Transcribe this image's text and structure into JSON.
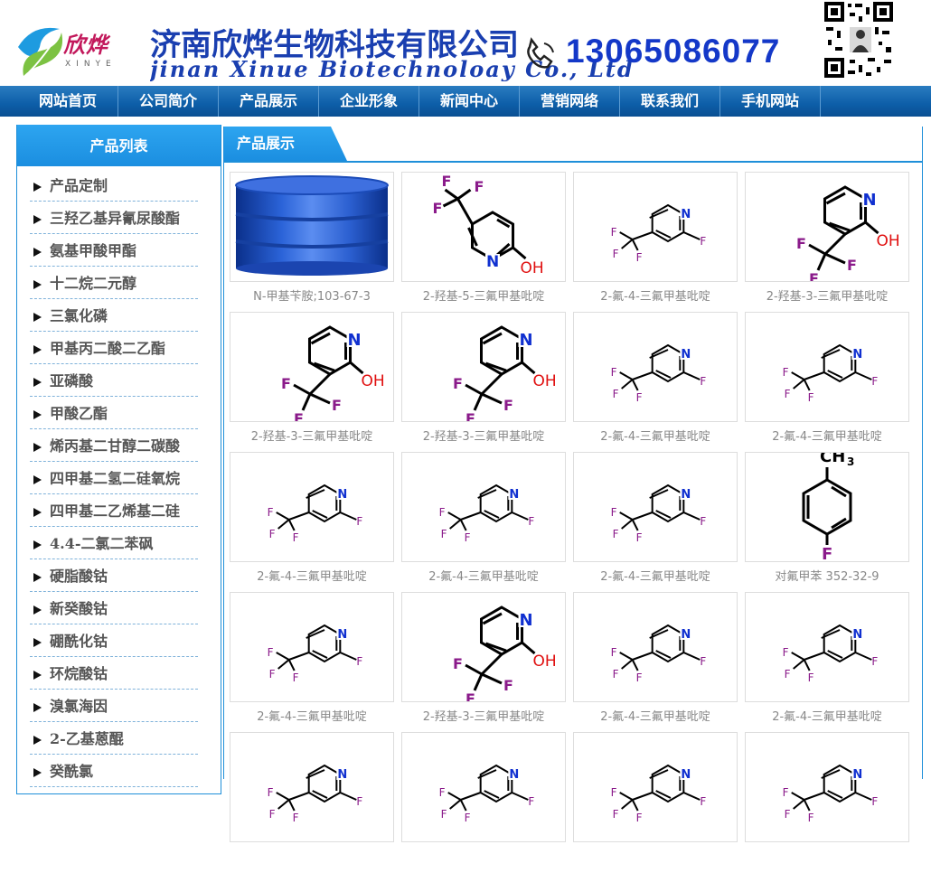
{
  "header": {
    "logo_cn": "欣烨",
    "logo_en": "XINYE",
    "company_cn": "济南欣烨生物科技有限公司",
    "company_en": "jinan Xinue Biotechnoloay Co., Ltd",
    "phone": "13065086077"
  },
  "nav": {
    "items": [
      "网站首页",
      "公司简介",
      "产品展示",
      "企业形象",
      "新闻中心",
      "营销网络",
      "联系我们",
      "手机网站"
    ]
  },
  "sidebar": {
    "title": "产品列表",
    "items": [
      "产品定制",
      "三羟乙基异氰尿酸酯",
      "氨基甲酸甲酯",
      "十二烷二元醇",
      "三氯化磷",
      "甲基丙二酸二乙酯",
      "亚磷酸",
      "甲酸乙酯",
      "烯丙基二甘醇二碳酸",
      "四甲基二氢二硅氧烷",
      "四甲基二乙烯基二硅",
      "4.4-二氯二苯砜",
      "硬脂酸钴",
      "新癸酸钴",
      "硼酰化钴",
      "环烷酸钴",
      "溴氯海因",
      "2-乙基蒽醌",
      "癸酰氯"
    ]
  },
  "main": {
    "title": "产品展示",
    "products": [
      {
        "caption": "N-甲基苄胺;103-67-3",
        "img": "drum"
      },
      {
        "caption": "2-羟基-5-三氟甲基吡啶",
        "img": "hydroxy5"
      },
      {
        "caption": "2-氟-4-三氟甲基吡啶",
        "img": "fluoro"
      },
      {
        "caption": "2-羟基-3-三氟甲基吡啶",
        "img": "hydroxy3"
      },
      {
        "caption": "2-羟基-3-三氟甲基吡啶",
        "img": "hydroxy3"
      },
      {
        "caption": "2-羟基-3-三氟甲基吡啶",
        "img": "hydroxy3"
      },
      {
        "caption": "2-氟-4-三氟甲基吡啶",
        "img": "fluoro"
      },
      {
        "caption": "2-氟-4-三氟甲基吡啶",
        "img": "fluoro"
      },
      {
        "caption": "2-氟-4-三氟甲基吡啶",
        "img": "fluoro"
      },
      {
        "caption": "2-氟-4-三氟甲基吡啶",
        "img": "fluoro"
      },
      {
        "caption": "2-氟-4-三氟甲基吡啶",
        "img": "fluoro"
      },
      {
        "caption": "对氟甲苯 352-32-9",
        "img": "fluorotoluene"
      },
      {
        "caption": "2-氟-4-三氟甲基吡啶",
        "img": "fluoro"
      },
      {
        "caption": "2-羟基-3-三氟甲基吡啶",
        "img": "hydroxy3"
      },
      {
        "caption": "2-氟-4-三氟甲基吡啶",
        "img": "fluoro"
      },
      {
        "caption": "2-氟-4-三氟甲基吡啶",
        "img": "fluoro"
      },
      {
        "caption": "",
        "img": "fluoro"
      },
      {
        "caption": "",
        "img": "fluoro"
      },
      {
        "caption": "",
        "img": "fluoro"
      },
      {
        "caption": "",
        "img": "fluoro"
      }
    ]
  },
  "colors": {
    "brand_blue": "#1a3fb0",
    "nav_blue": "#0d5ea8",
    "accent_blue": "#1e8fd9"
  }
}
